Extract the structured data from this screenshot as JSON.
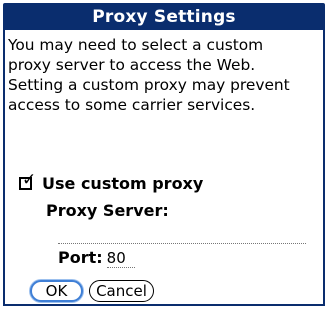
{
  "dialog": {
    "title": "Proxy Settings",
    "message_lines": [
      "You may need to select a custom",
      "proxy server to access the Web.",
      "Setting a custom proxy may prevent",
      "access to some carrier services."
    ],
    "use_custom_proxy": {
      "label": "Use custom proxy",
      "checked": true
    },
    "proxy_server": {
      "label": "Proxy Server:",
      "value": ""
    },
    "port": {
      "label": "Port:",
      "value": "80"
    },
    "buttons": {
      "ok": "OK",
      "cancel": "Cancel"
    }
  },
  "colors": {
    "title_bar": "#0a2d6e",
    "focus_ring": "#3f7fd6"
  },
  "icons": {
    "checkbox": "checkmark-icon"
  }
}
